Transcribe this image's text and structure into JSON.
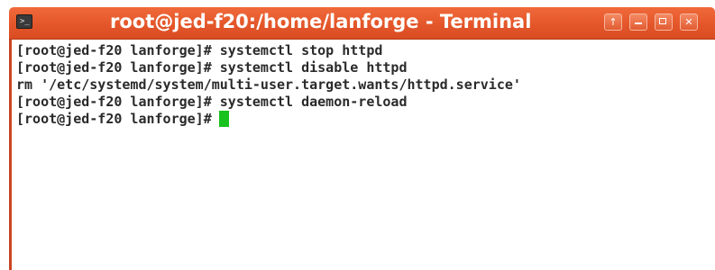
{
  "window": {
    "title": "root@jed-f20:/home/lanforge - Terminal",
    "app_icon_glyph": ">_",
    "buttons": {
      "up": "↑",
      "minimize": "",
      "maximize": "",
      "close": "✕"
    },
    "colors": {
      "titlebar": "#e4562a",
      "cursor": "#19c21d",
      "background": "#ffffff",
      "text": "#2a2a2a"
    }
  },
  "terminal": {
    "lines": [
      "[root@jed-f20 lanforge]# systemctl stop httpd",
      "[root@jed-f20 lanforge]# systemctl disable httpd",
      "rm '/etc/systemd/system/multi-user.target.wants/httpd.service'",
      "[root@jed-f20 lanforge]# systemctl daemon-reload"
    ],
    "prompt": "[root@jed-f20 lanforge]#"
  }
}
